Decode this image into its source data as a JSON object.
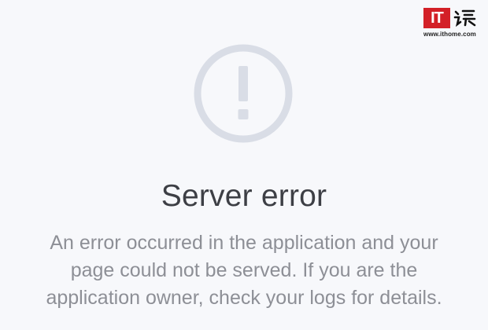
{
  "watermark": {
    "logo_text": "IT",
    "url": "www.ithome.com"
  },
  "error": {
    "icon": "exclamation-circle-icon",
    "title": "Server error",
    "message_lines": [
      "An error occurred in the application and your",
      "page could not be served. If you are the",
      "application owner, check your logs for details."
    ]
  },
  "colors": {
    "background": "#f7f8fb",
    "icon": "#d9dde6",
    "title": "#3d3f45",
    "message": "#8d8f96",
    "brand_red": "#d32027"
  }
}
